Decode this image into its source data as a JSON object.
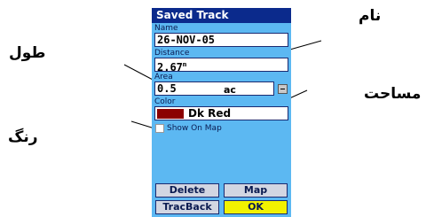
{
  "callouts": {
    "name": "نام",
    "length": "طول",
    "area": "مساحت",
    "color": "رنگ"
  },
  "device": {
    "title": "Saved Track",
    "name": {
      "label": "Name",
      "value": "26-NOV-05"
    },
    "distance": {
      "label": "Distance",
      "value": "2.67",
      "unit_mark": "m"
    },
    "area": {
      "label": "Area",
      "value": "0.5",
      "unit": "ac"
    },
    "color": {
      "label": "Color",
      "value": "Dk Red",
      "swatch": "#8b0000"
    },
    "show_on_map": {
      "label": "Show On Map",
      "checked": false
    },
    "buttons": {
      "delete": "Delete",
      "map": "Map",
      "trackback": "TracBack",
      "ok": "OK"
    }
  },
  "colors": {
    "screen_bg": "#5cb8f2",
    "title_bg": "#0b2a8c",
    "ok_button": "#f2f200",
    "track_color": "#8b0000"
  }
}
